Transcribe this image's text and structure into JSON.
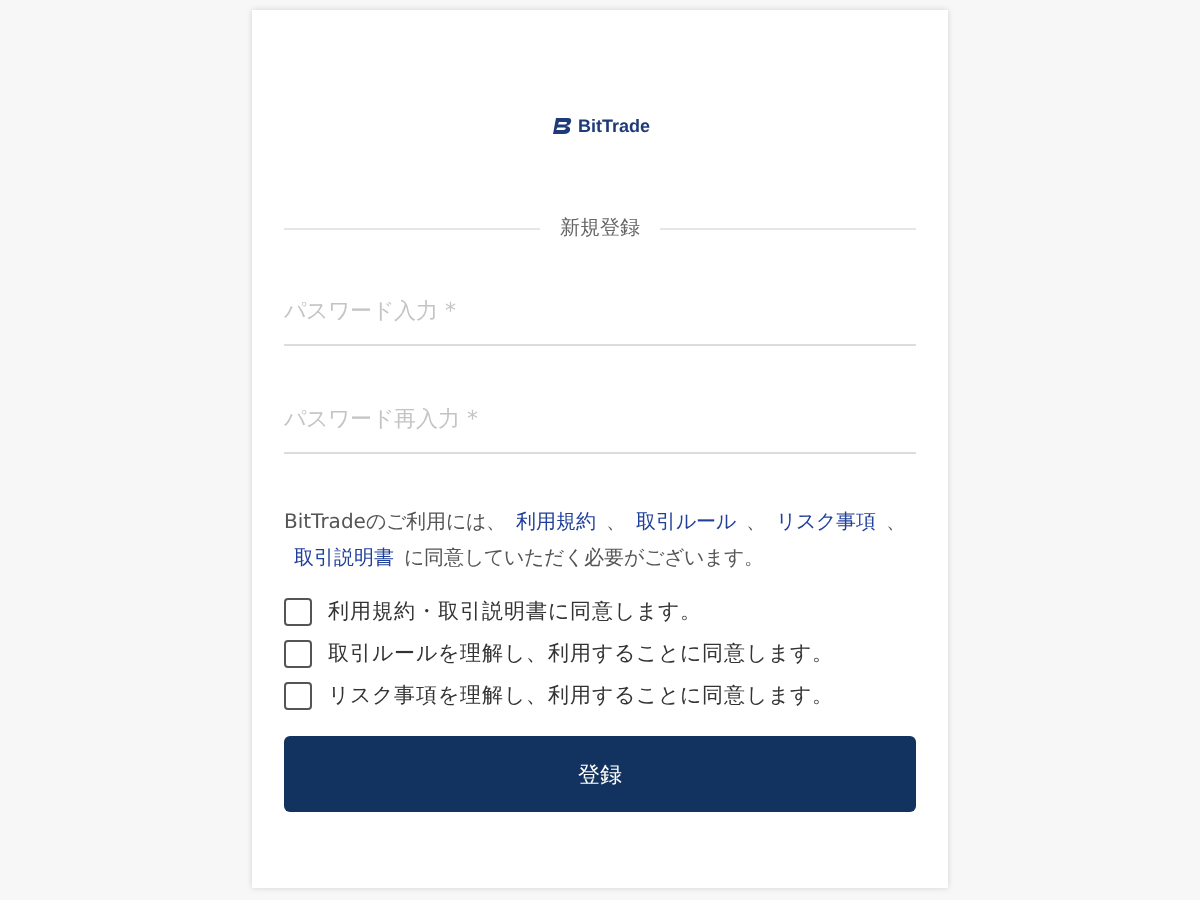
{
  "logo": {
    "text": "BitTrade"
  },
  "heading": "新規登録",
  "fields": [
    {
      "placeholder": "パスワード入力 *"
    },
    {
      "placeholder": "パスワード再入力 *"
    }
  ],
  "notice": [
    {
      "kind": "text",
      "text": "BitTradeのご利用には、"
    },
    {
      "kind": "link",
      "text": "利用規約"
    },
    {
      "kind": "text",
      "text": "、"
    },
    {
      "kind": "link",
      "text": "取引ルール"
    },
    {
      "kind": "text",
      "text": "、"
    },
    {
      "kind": "link",
      "text": "リスク事項"
    },
    {
      "kind": "text",
      "text": "、"
    },
    {
      "kind": "link",
      "text": "取引説明書"
    },
    {
      "kind": "text",
      "text": "に同意していただく必要がございます。"
    }
  ],
  "agreements": [
    {
      "label": "利用規約・取引説明書に同意します。",
      "checked": false
    },
    {
      "label": "取引ルールを理解し、利用することに同意します。",
      "checked": false
    },
    {
      "label": "リスク事項を理解し、利用することに同意します。",
      "checked": false
    }
  ],
  "submit": "登録"
}
